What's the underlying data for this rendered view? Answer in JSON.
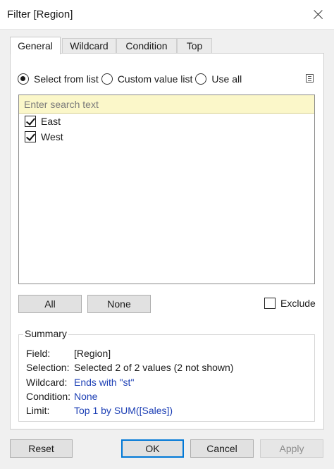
{
  "window": {
    "title": "Filter [Region]"
  },
  "tabs": [
    {
      "label": "General"
    },
    {
      "label": "Wildcard"
    },
    {
      "label": "Condition"
    },
    {
      "label": "Top"
    }
  ],
  "general": {
    "radios": [
      {
        "label": "Select from list",
        "selected": true
      },
      {
        "label": "Custom value list",
        "selected": false
      },
      {
        "label": "Use all",
        "selected": false
      }
    ],
    "search_placeholder": "Enter search text",
    "items": [
      {
        "label": "East",
        "checked": true
      },
      {
        "label": "West",
        "checked": true
      }
    ],
    "all_label": "All",
    "none_label": "None",
    "exclude_label": "Exclude"
  },
  "summary": {
    "heading": "Summary",
    "rows": [
      {
        "key": "Field:",
        "value": "[Region]"
      },
      {
        "key": "Selection:",
        "value": "Selected 2 of 2 values (2 not shown)"
      },
      {
        "key": "Wildcard:",
        "value": "Ends with \"st\""
      },
      {
        "key": "Condition:",
        "value": "None"
      },
      {
        "key": "Limit:",
        "value": "Top 1 by SUM([Sales])"
      }
    ]
  },
  "footer": {
    "reset_label": "Reset",
    "ok_label": "OK",
    "cancel_label": "Cancel",
    "apply_label": "Apply"
  },
  "colors": {
    "accent": "#0078d7",
    "summary_link": "#1c3fb5",
    "search_bg": "#fbf7c9"
  }
}
